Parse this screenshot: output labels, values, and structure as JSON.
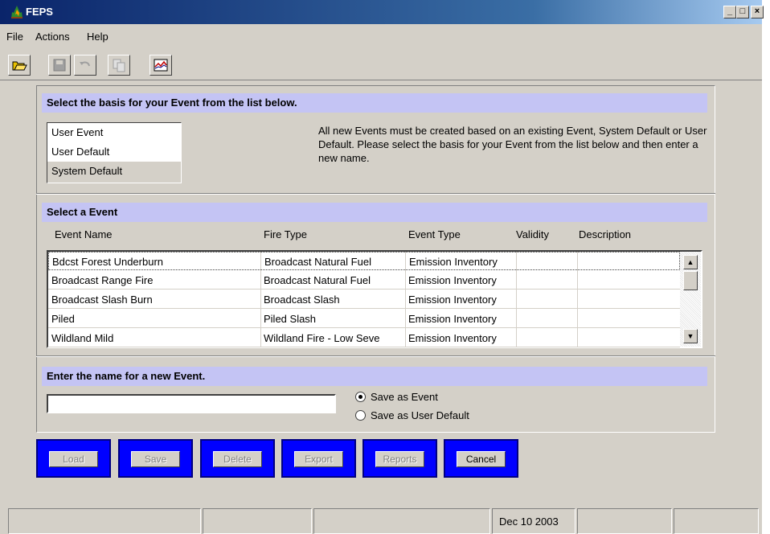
{
  "window": {
    "title": "FEPS"
  },
  "menu": [
    "File",
    "Actions",
    "Help"
  ],
  "toolbar": {
    "icons": [
      "open-folder-icon",
      "save-icon",
      "undo-icon",
      "copy-icon",
      "chart-icon"
    ]
  },
  "basis": {
    "header": "Select the basis for your Event from the list below.",
    "items": [
      "User Event",
      "User Default",
      "System Default"
    ],
    "description": "All new Events must be created based on an existing Event, System Default or User Default. Please select the basis for your Event from the list below and then enter a new name."
  },
  "events": {
    "header": "Select a Event",
    "columns": [
      "Event Name",
      "Fire Type",
      "Event Type",
      "Validity",
      "Description"
    ],
    "rows": [
      {
        "name": "Bdcst Forest Underburn",
        "fire_type": "Broadcast Natural Fuel",
        "event_type": "Emission Inventory",
        "validity": "",
        "description": ""
      },
      {
        "name": "Broadcast Range Fire",
        "fire_type": "Broadcast Natural Fuel",
        "event_type": "Emission Inventory",
        "validity": "",
        "description": ""
      },
      {
        "name": "Broadcast Slash Burn",
        "fire_type": "Broadcast Slash",
        "event_type": "Emission Inventory",
        "validity": "",
        "description": ""
      },
      {
        "name": "Piled",
        "fire_type": "Piled Slash",
        "event_type": "Emission Inventory",
        "validity": "",
        "description": ""
      },
      {
        "name": "Wildland Mild",
        "fire_type": "Wildland Fire - Low Seve",
        "event_type": "Emission Inventory",
        "validity": "",
        "description": ""
      }
    ]
  },
  "new_event": {
    "header": "Enter the name for a new Event.",
    "value": "",
    "options": [
      "Save as Event",
      "Save as User Default"
    ],
    "selected": "Save as Event"
  },
  "buttons": {
    "load": "Load",
    "save": "Save",
    "delete": "Delete",
    "export": "Export",
    "reports": "Reports",
    "cancel": "Cancel"
  },
  "status": {
    "date": "Dec 10 2003"
  },
  "colors": {
    "section_header": "#c4c4f4",
    "button_frame": "#0000ff",
    "titlebar": "#0a246a"
  }
}
